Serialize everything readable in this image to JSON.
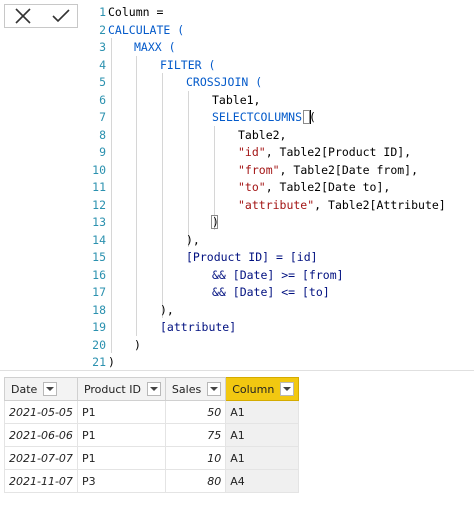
{
  "toolbar": {
    "cancel_icon": "close-icon",
    "commit_icon": "check-icon"
  },
  "editor": {
    "line_numbers": [
      "1",
      "2",
      "3",
      "4",
      "5",
      "6",
      "7",
      "8",
      "9",
      "10",
      "11",
      "12",
      "13",
      "14",
      "15",
      "16",
      "17",
      "18",
      "19",
      "20",
      "21"
    ],
    "lines": {
      "l1": "Column =",
      "l2": "CALCULATE (",
      "l3": "MAXX (",
      "l4": "FILTER (",
      "l5": "CROSSJOIN (",
      "l6": "Table1,",
      "l7": "SELECTCOLUMNS",
      "l7p": "(",
      "l8": "Table2,",
      "l9s": "\"id\"",
      "l9r": ", Table2[Product ID],",
      "l10s": "\"from\"",
      "l10r": ", Table2[Date from],",
      "l11s": "\"to\"",
      "l11r": ", Table2[Date to],",
      "l12s": "\"attribute\"",
      "l12r": ", Table2[Attribute]",
      "l13": ")",
      "l14": "),",
      "l15": "[Product ID] = [id]",
      "l16": "&& [Date] >= [from]",
      "l17": "&& [Date] <= [to]",
      "l18": "),",
      "l19": "[attribute]",
      "l20": ")",
      "l21": ")"
    }
  },
  "table": {
    "columns": [
      "Date",
      "Product ID",
      "Sales",
      "Column"
    ],
    "rows": [
      [
        "2021-05-05",
        "P1",
        "50",
        "A1"
      ],
      [
        "2021-06-06",
        "P1",
        "75",
        "A1"
      ],
      [
        "2021-07-07",
        "P1",
        "10",
        "A1"
      ],
      [
        "2021-11-07",
        "P3",
        "80",
        "A4"
      ]
    ],
    "active_column_color": "#f2c811"
  }
}
